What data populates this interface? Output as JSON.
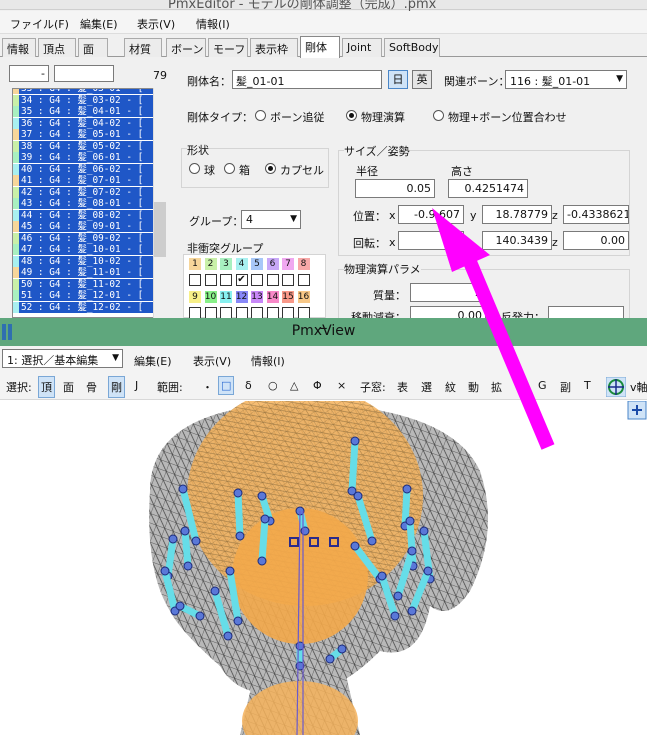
{
  "editor": {
    "title": "PmxEditor - モデルの剛体調整（完成）.pmx",
    "menu": [
      "ファイル(F)",
      "編集(E)",
      "表示(V)",
      "情報(I)"
    ],
    "tabs": [
      "情報",
      "頂点",
      "面",
      "材質",
      "ボーン",
      "モーフ",
      "表示枠",
      "剛体",
      "Joint",
      "SoftBody"
    ],
    "active_tab": "剛体",
    "filter_value": "-",
    "count": "79",
    "list_rows": [
      "33 : G4 : 髪_03-01 - [",
      "34 : G4 : 髪_03-02 - [",
      "35 : G4 : 髪_04-01 - [",
      "36 : G4 : 髪_04-02 - [",
      "37 : G4 : 髪_05-01 - [",
      "38 : G4 : 髪_05-02 - [",
      "39 : G4 : 髪_06-01 - [",
      "40 : G4 : 髪_06-02 - [",
      "41 : G4 : 髪_07-01 - [",
      "42 : G4 : 髪_07-02 - [",
      "43 : G4 : 髪_08-01 - [",
      "44 : G4 : 髪_08-02 - [",
      "45 : G4 : 髪_09-01 - [",
      "46 : G4 : 髪_09-02 - [",
      "47 : G4 : 髪_10-01 - [",
      "48 : G4 : 髪_10-02 - [",
      "49 : G4 : 髪_11-01 - [",
      "50 : G4 : 髪_11-02 - [",
      "51 : G4 : 髪_12-01 - [",
      "52 : G4 : 髪_12-02 - ["
    ],
    "body_name_label": "剛体名：",
    "body_name_value": "髪_01-01",
    "lang_jp": "日",
    "lang_en": "英",
    "related_bone_label": "関連ボーン：",
    "related_bone_value": "116 : 髪_01-01",
    "body_type_label": "剛体タイプ：",
    "body_types": [
      "ボーン追従",
      "物理演算",
      "物理+ボーン位置合わせ"
    ],
    "body_type_selected": "物理演算",
    "shape_label": "形状",
    "shapes": [
      "球",
      "箱",
      "カプセル"
    ],
    "shape_selected": "カプセル",
    "size_label": "サイズ／姿勢",
    "radius_label": "半径",
    "radius_value": "0.05",
    "height_label": "高さ",
    "height_value": "0.4251474",
    "position_label": "位置：",
    "pos_x_label": "x",
    "pos_x": "-0.9   607",
    "pos_y_label": "y",
    "pos_y": "18.78779",
    "pos_z_label": "z",
    "pos_z": "-0.4338621",
    "rotation_label": "回転：",
    "rot_x_label": "x",
    "rot_x": "-",
    "rot_y": "140.3439",
    "rot_z_label": "z",
    "rot_z": "0.00",
    "group_label": "グループ：",
    "group_value": "4",
    "no_collision_label": "非衝突グループ",
    "group_numbers": [
      "1",
      "2",
      "3",
      "4",
      "5",
      "6",
      "7",
      "8",
      "9",
      "10",
      "11",
      "12",
      "13",
      "14",
      "15",
      "16"
    ],
    "group_colors": [
      "#f7d69a",
      "#c9f0a8",
      "#a8f0c0",
      "#a8f0f0",
      "#a8c8f8",
      "#c8a8f8",
      "#f0a8f0",
      "#f8a8a8",
      "#f8f088",
      "#88f088",
      "#88f0f0",
      "#8888f8",
      "#c888f8",
      "#f888c8",
      "#f89888",
      "#f8c888"
    ],
    "no_collision_checked": [
      4
    ],
    "physics_label": "物理演算パラメ",
    "mass_label": "質量：",
    "mass_value": "2",
    "move_decay_label": "移動減衰：",
    "move_decay_value": "0.00",
    "repulsion_label": "反発力："
  },
  "viewer": {
    "title": "PmxView",
    "mode_value": "1: 選択／基本編集",
    "menu": [
      "編集(E)",
      "表示(V)",
      "情報(I)"
    ],
    "toolbar_items": [
      "選択:",
      "頂",
      "面",
      "骨",
      "剛",
      "J",
      "範囲:",
      "・",
      "□",
      "δ",
      "○",
      "△",
      "Φ",
      "×",
      "子窓:",
      "表",
      "選",
      "紋",
      "動",
      "拡",
      "G",
      "副",
      "T"
    ],
    "accent": "#ff00ff",
    "hair_color": "#f5b25a",
    "capsule_color": "#66dde8",
    "title_bar_color": "#5fa77d"
  }
}
